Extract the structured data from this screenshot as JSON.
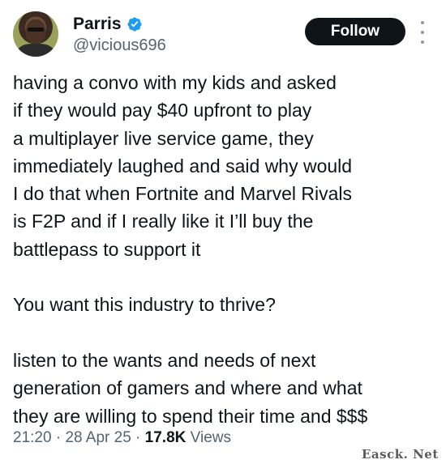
{
  "author": {
    "display_name": "Parris",
    "handle": "@vicious696",
    "verified": true,
    "avatar_icon": "profile-photo"
  },
  "header": {
    "follow_label": "Follow",
    "more_icon": "vertical-ellipsis-icon"
  },
  "tweet": {
    "lines": [
      "having a convo with my kids and asked",
      "if they would pay $40 upfront to play",
      "a multiplayer live service game, they",
      "immediately laughed and said why would",
      "I do that when Fortnite and Marvel Rivals",
      "is F2P and if I really like it I’ll buy the",
      "battlepass to support it",
      "",
      "You want this industry to thrive?",
      "",
      "listen to the wants and needs of next",
      "generation of gamers and where and what",
      "they are willing to spend their time and $$$"
    ]
  },
  "meta": {
    "time": "21:20",
    "separator": " · ",
    "date": "28 Apr 25",
    "views_count": "17.8K",
    "views_label": " Views"
  },
  "watermark": "Easck. Net",
  "colors": {
    "text": "#0f1419",
    "secondary": "#536471",
    "verified": "#1d9bf0",
    "button_bg": "#0f1419",
    "button_text": "#ffffff"
  }
}
